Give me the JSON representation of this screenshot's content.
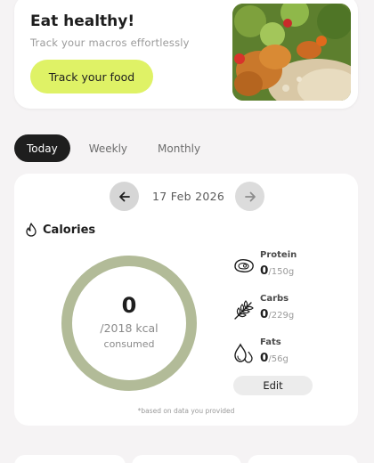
{
  "promo": {
    "title": "Eat healthy!",
    "subtitle": "Track your macros effortlessly",
    "button_label": "Track your food",
    "image_icon": "food-bowl-photo"
  },
  "tabs": [
    {
      "label": "Today",
      "active": true
    },
    {
      "label": "Weekly",
      "active": false
    },
    {
      "label": "Monthly",
      "active": false
    }
  ],
  "date_nav": {
    "date": "17 Feb 2026",
    "prev_icon": "arrow-left-icon",
    "next_icon": "arrow-right-icon"
  },
  "calories": {
    "title": "Calories",
    "icon": "flame-icon",
    "value": "0",
    "goal": "/2018 kcal",
    "caption": "consumed",
    "ring_color": "#b2bb98"
  },
  "macros": [
    {
      "name": "Protein",
      "current": "0",
      "goal": "/150g",
      "icon": "steak-icon"
    },
    {
      "name": "Carbs",
      "current": "0",
      "goal": "/229g",
      "icon": "wheat-icon"
    },
    {
      "name": "Fats",
      "current": "0",
      "goal": "/56g",
      "icon": "oil-drops-icon"
    }
  ],
  "edit_label": "Edit",
  "footnote": "*based on data you provided",
  "colors": {
    "accent": "#dff266",
    "background": "#f5f3f4",
    "dark": "#1e1e1e"
  }
}
